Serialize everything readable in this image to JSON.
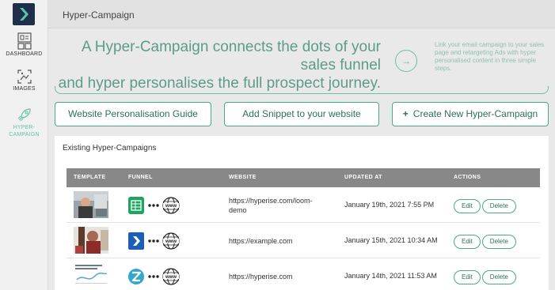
{
  "sidebar": {
    "items": [
      {
        "label": "DASHBOARD",
        "icon": "dashboard-icon"
      },
      {
        "label": "IMAGES",
        "icon": "images-icon"
      },
      {
        "label": "HYPER-CAMPAIGN",
        "icon": "rocket-icon"
      }
    ]
  },
  "header": {
    "title": "Hyper-Campaign"
  },
  "hero": {
    "headline_line1": "A Hyper-Campaign connects the dots of your sales funnel",
    "headline_line2": "and hyper personalises the full prospect journey.",
    "arrow": "→",
    "subtext": "Link your email campaign to your sales page and retargeting Ads with hyper personalised content in three simple steps."
  },
  "buttons": {
    "guide": "Website Personalisation Guide",
    "snippet": "Add Snippet to your website",
    "create_plus": "+",
    "create": "Create New Hyper-Campaign"
  },
  "table": {
    "title": "Existing Hyper-Campaigns",
    "columns": [
      "TEMPLATE",
      "FUNNEL",
      "WEBSITE",
      "UPDATED AT",
      "ACTIONS"
    ],
    "rows": [
      {
        "funnel_icon": "google-sheets-icon",
        "website": "https://hyperise.com/loom-demo",
        "updated": "January 19th, 2021 7:55 PM"
      },
      {
        "funnel_icon": "hyperise-logo-icon",
        "website": "https://example.com",
        "updated": "January 15th, 2021 10:34 AM"
      },
      {
        "funnel_icon": "zapier-z-icon",
        "website": "https://hyperise.com",
        "updated": "January 14th, 2021 11:53 AM"
      }
    ],
    "edit_label": "Edit",
    "delete_label": "Delete",
    "www_label": "www"
  },
  "colors": {
    "accent": "#4aa88d",
    "logo_bg": "#1f2f49",
    "header_row": "#888888"
  }
}
